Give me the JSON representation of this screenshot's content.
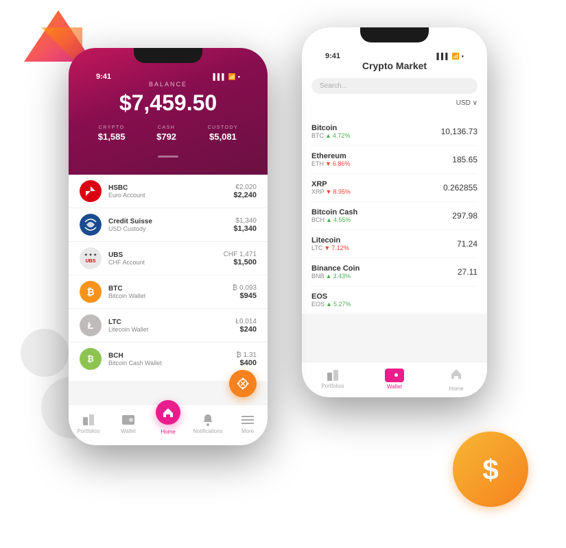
{
  "decorations": {
    "shapes": [
      "top-left polygon",
      "left-mid circle",
      "right polygon",
      "dollar-circle"
    ]
  },
  "phone_left": {
    "status": {
      "time": "9:41",
      "signal": "▌▌▌",
      "wifi": "WiFi",
      "battery": "🔋"
    },
    "header": {
      "balance_label": "BALANCE",
      "balance_amount": "$7,459.50",
      "crypto_label": "CRYPTO",
      "crypto_value": "$1,585",
      "cash_label": "CASH",
      "cash_value": "$792",
      "custody_label": "CUSTODY",
      "custody_value": "$5,081"
    },
    "accounts": [
      {
        "bank": "HSBC",
        "type": "Euro Account",
        "native": "€2,020",
        "usd": "$2,240",
        "logo_type": "hsbc"
      },
      {
        "bank": "Credit Suisse",
        "type": "USD Custody",
        "native": "$1,340",
        "usd": "$1,340",
        "logo_type": "credit-suisse"
      },
      {
        "bank": "UBS",
        "type": "CHF Account",
        "native": "CHF 1,471",
        "usd": "$1,500",
        "logo_type": "ubs"
      },
      {
        "bank": "BTC",
        "type": "Bitcoin Wallet",
        "native": "₿ 0.093",
        "usd": "$945",
        "logo_type": "btc"
      },
      {
        "bank": "LTC",
        "type": "Litecoin Wallet",
        "native": "Ł0.014",
        "usd": "$240",
        "logo_type": "ltc"
      },
      {
        "bank": "BCH",
        "type": "Bitcoin Cash Wallet",
        "native": "₿ 1.31",
        "usd": "$400",
        "logo_type": "bch"
      }
    ],
    "nav": [
      {
        "label": "Portfolios",
        "icon": "chart",
        "active": false
      },
      {
        "label": "Wallet",
        "icon": "wallet",
        "active": false
      },
      {
        "label": "Home",
        "icon": "home",
        "active": true
      },
      {
        "label": "Notifications",
        "icon": "bell",
        "active": false
      },
      {
        "label": "More",
        "icon": "menu",
        "active": false
      }
    ]
  },
  "phone_right": {
    "status": {
      "time": "9:41",
      "signal": "▌▌▌",
      "wifi": "WiFi",
      "battery": "🔋"
    },
    "header": {
      "title": "Crypto Market",
      "search_placeholder": "Search...",
      "currency": "USD ∨"
    },
    "cryptos": [
      {
        "name": "Bitcoin",
        "ticker": "BTC",
        "change": "4.72%",
        "change_dir": "up",
        "price": "10,136.73"
      },
      {
        "name": "Ethereum",
        "ticker": "ETH",
        "change": "6.86%",
        "change_dir": "down",
        "price": "185.65"
      },
      {
        "name": "XRP",
        "ticker": "XRP",
        "change": "8.95%",
        "change_dir": "down",
        "price": "0.262855"
      },
      {
        "name": "Bitcoin Cash",
        "ticker": "BCH",
        "change": "4.55%",
        "change_dir": "up",
        "price": "297.98"
      },
      {
        "name": "Litecoin",
        "ticker": "LTC",
        "change": "7.12%",
        "change_dir": "down",
        "price": "71.24"
      },
      {
        "name": "Binance Coin",
        "ticker": "BNB",
        "change": "3.43%",
        "change_dir": "up",
        "price": "27.11"
      },
      {
        "name": "EOS",
        "ticker": "EOS",
        "change": "5.27%",
        "change_dir": "up",
        "price": ""
      }
    ],
    "nav": [
      {
        "label": "Portfolios",
        "icon": "chart",
        "active": false
      },
      {
        "label": "Wallet",
        "icon": "wallet",
        "active": true
      },
      {
        "label": "Home",
        "icon": "home",
        "active": false
      }
    ]
  }
}
